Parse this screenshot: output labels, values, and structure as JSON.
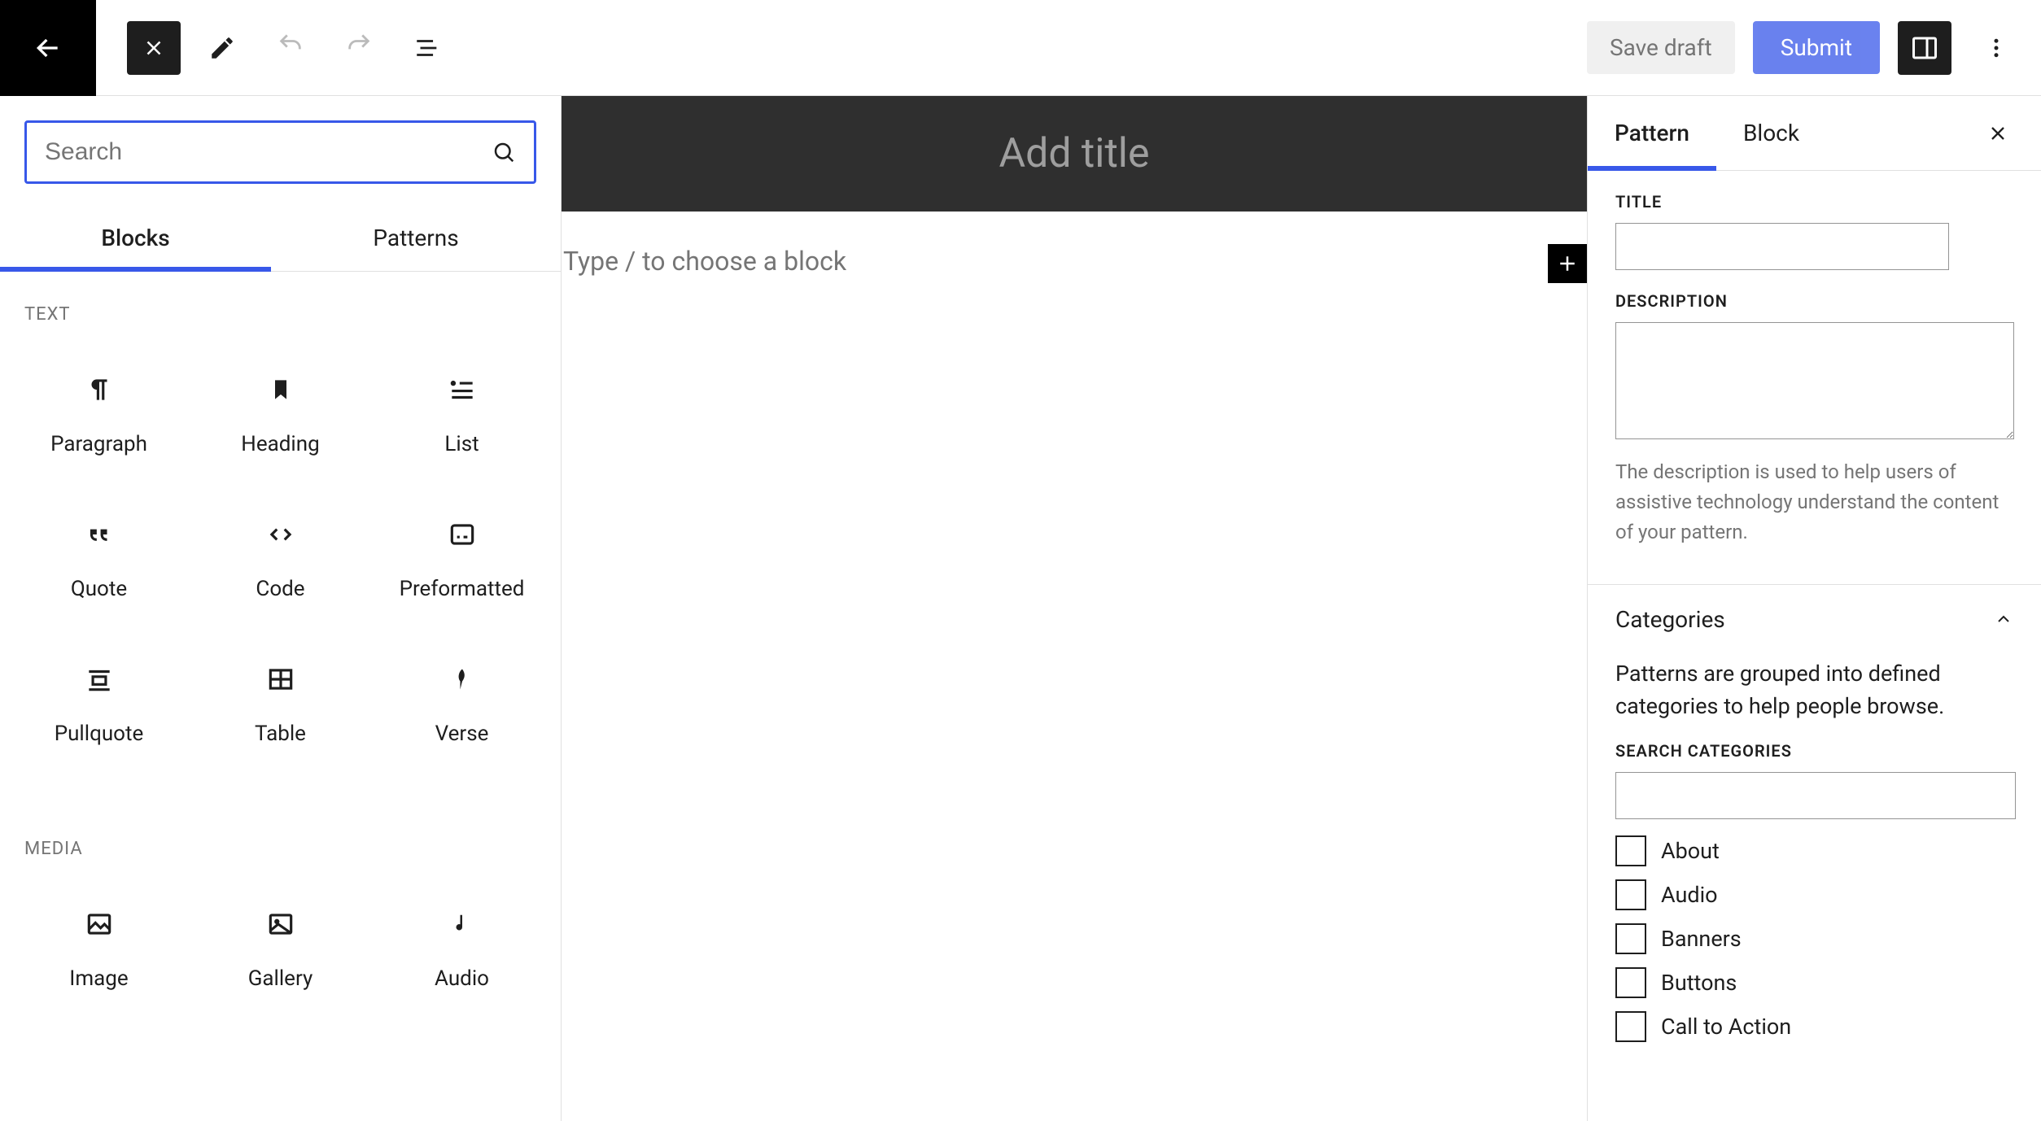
{
  "header": {
    "save_draft": "Save draft",
    "submit": "Submit"
  },
  "inserter": {
    "search_placeholder": "Search",
    "tabs": {
      "blocks": "Blocks",
      "patterns": "Patterns"
    },
    "categories": {
      "text": {
        "label": "TEXT",
        "items": [
          {
            "name": "Paragraph"
          },
          {
            "name": "Heading"
          },
          {
            "name": "List"
          },
          {
            "name": "Quote"
          },
          {
            "name": "Code"
          },
          {
            "name": "Preformatted"
          },
          {
            "name": "Pullquote"
          },
          {
            "name": "Table"
          },
          {
            "name": "Verse"
          }
        ]
      },
      "media": {
        "label": "MEDIA",
        "items": [
          {
            "name": "Image"
          },
          {
            "name": "Gallery"
          },
          {
            "name": "Audio"
          }
        ]
      }
    }
  },
  "canvas": {
    "title_placeholder": "Add title",
    "content_prompt": "Type / to choose a block"
  },
  "sidebar": {
    "tabs": {
      "pattern": "Pattern",
      "block": "Block"
    },
    "title_label": "TITLE",
    "title_value": "",
    "description_label": "DESCRIPTION",
    "description_value": "",
    "description_help": "The description is used to help users of assistive technology understand the content of your pattern.",
    "categories": {
      "header": "Categories",
      "desc": "Patterns are grouped into defined categories to help people browse.",
      "search_label": "SEARCH CATEGORIES",
      "search_value": "",
      "items": [
        {
          "label": "About"
        },
        {
          "label": "Audio"
        },
        {
          "label": "Banners"
        },
        {
          "label": "Buttons"
        },
        {
          "label": "Call to Action"
        }
      ]
    }
  }
}
